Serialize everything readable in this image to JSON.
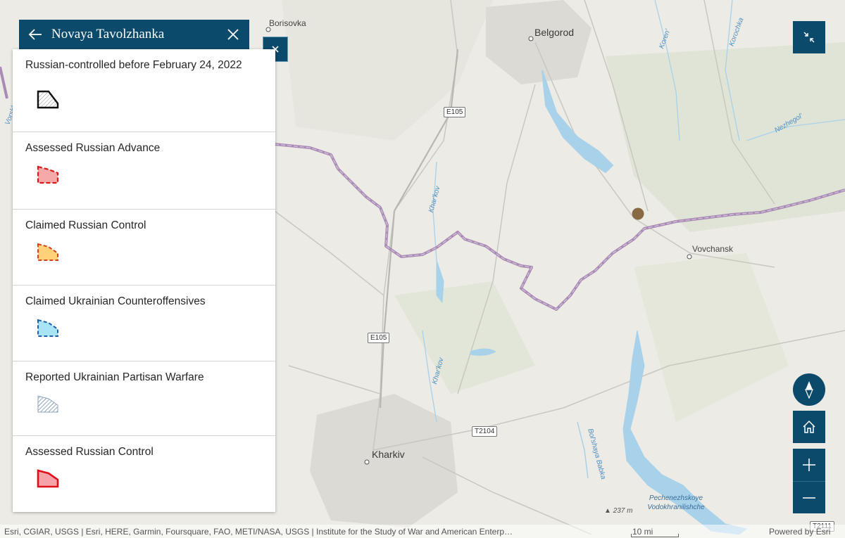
{
  "panel": {
    "title": "Novaya Tavolzhanka",
    "back_icon": "arrow-left-icon",
    "close_icon": "close-icon",
    "collapse_icon": "close-icon"
  },
  "legend": {
    "items": [
      {
        "label": "Russian-controlled before February 24, 2022",
        "symbol": "black-hatched-polygon",
        "stroke": "#111111",
        "fill": "#ffffff"
      },
      {
        "label": "Assessed Russian Advance",
        "symbol": "red-dashed-polygon",
        "stroke": "#d81a1a",
        "fill": "#f6a9a9"
      },
      {
        "label": "Claimed Russian Control",
        "symbol": "orange-dashed-polygon",
        "stroke": "#d8401a",
        "fill": "#ffd27a"
      },
      {
        "label": "Claimed Ukrainian Counteroffensives",
        "symbol": "blue-dashed-polygon",
        "stroke": "#1f5fb0",
        "fill": "#a9e4f6"
      },
      {
        "label": "Reported Ukrainian Partisan Warfare",
        "symbol": "blue-hatched-polygon",
        "stroke": "#4a6f9a",
        "fill": "#ffffff"
      },
      {
        "label": "Assessed Russian Control",
        "symbol": "red-solid-polygon",
        "stroke": "#e0101a",
        "fill": "#f5a3a8"
      }
    ]
  },
  "map": {
    "places": {
      "borisovka": "Borisovka",
      "belgorod": "Belgorod",
      "vovchansk": "Vovchansk",
      "kharkiv": "Kharkiv"
    },
    "rivers": {
      "koren": "Koren'",
      "korochka": "Korochka",
      "nezhegol": "Nezhegol'",
      "kharkov1": "Khar'kov",
      "kharkov2": "Khar'kov",
      "bolshaya_babka": "Bol'shaya Babka",
      "vorskla": "Vorsklytsya"
    },
    "roads": {
      "e105_top": "E105",
      "e105_mid": "E105",
      "t2104": "T2104",
      "t2111": "T2111"
    },
    "elevation": "237 m",
    "reservoir": [
      "Pechenezhskoye",
      "Vodokhranilishche"
    ],
    "marker_color": "#8a6a45",
    "border_color": "#a98bb5",
    "water_color": "#a8d1ea"
  },
  "controls": {
    "collapse_icon": "collapse-arrows-icon",
    "compass_icon": "compass-icon",
    "home_icon": "home-icon",
    "zoom_in_icon": "plus-icon",
    "zoom_out_icon": "minus-icon",
    "accent": "#0b4a6a"
  },
  "footer": {
    "attribution": "Esri, CGIAR, USGS | Esri, HERE, Garmin, Foursquare, FAO, METI/NASA, USGS | Institute for the Study of War and American Enterp…",
    "scale": "10 mi",
    "powered": "Powered by Esri"
  }
}
